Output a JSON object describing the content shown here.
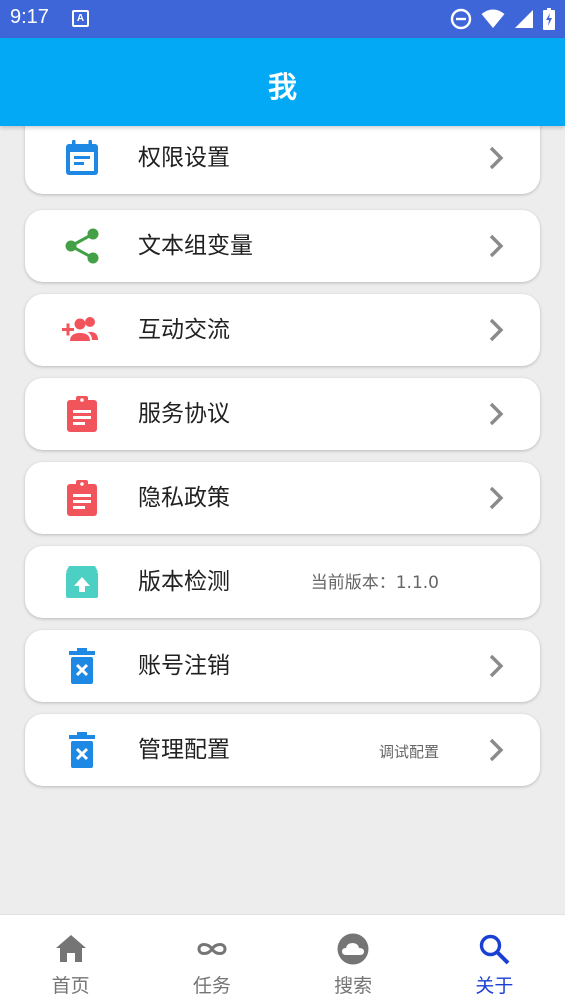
{
  "status_bar": {
    "time": "9:17",
    "indicator": "A"
  },
  "header": {
    "title": "我"
  },
  "colors": {
    "status_bar": "#3f66d9",
    "header": "#03a9f4",
    "nav_active": "#1a3fd4",
    "icon_blue": "#1e88e5",
    "icon_green": "#43a047",
    "icon_red": "#f2545b",
    "icon_teal": "#4dd0c4"
  },
  "menu": [
    {
      "label": "权限设置",
      "icon": "calendar-icon",
      "value": ""
    },
    {
      "label": "文本组变量",
      "icon": "share-icon",
      "value": ""
    },
    {
      "label": "互动交流",
      "icon": "group-add-icon",
      "value": ""
    },
    {
      "label": "服务协议",
      "icon": "clipboard-icon",
      "value": ""
    },
    {
      "label": "隐私政策",
      "icon": "clipboard-icon",
      "value": ""
    },
    {
      "label": "版本检测",
      "icon": "archive-upload-icon",
      "value": "当前版本：1.1.0"
    },
    {
      "label": "账号注销",
      "icon": "trash-icon",
      "value": ""
    },
    {
      "label": "管理配置",
      "icon": "trash-icon",
      "value": "调试配置"
    }
  ],
  "bottom_nav": [
    {
      "label": "首页",
      "icon": "home-icon",
      "active": false
    },
    {
      "label": "任务",
      "icon": "infinity-icon",
      "active": false
    },
    {
      "label": "搜索",
      "icon": "cloud-icon",
      "active": false
    },
    {
      "label": "关于",
      "icon": "search-icon",
      "active": true
    }
  ]
}
